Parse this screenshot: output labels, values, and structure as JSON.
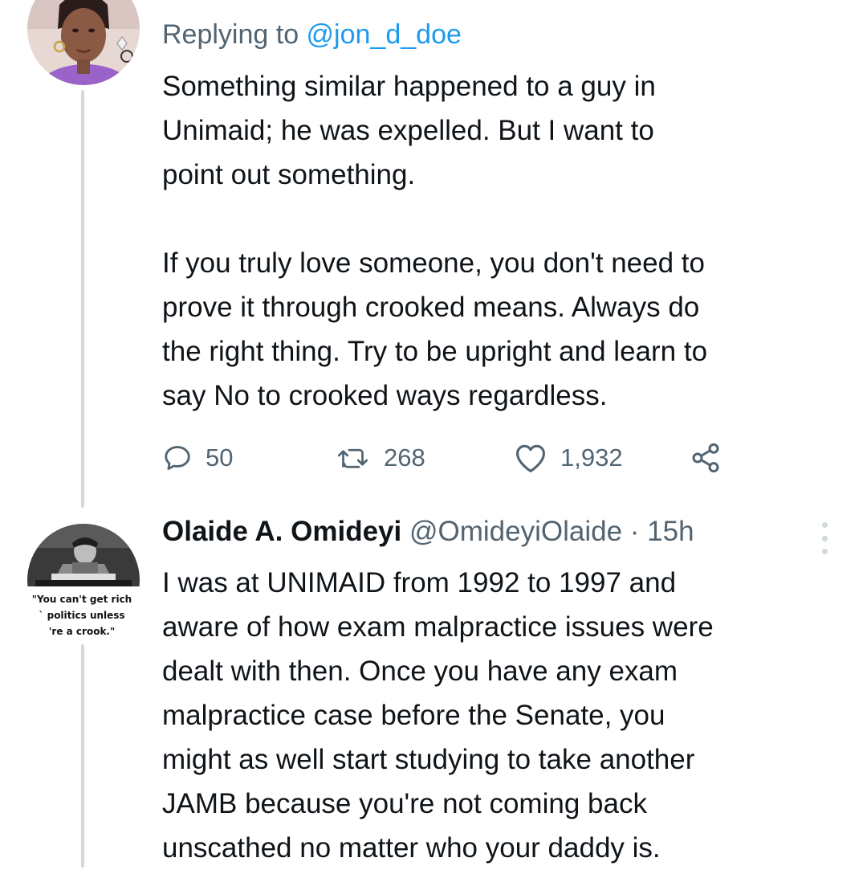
{
  "reply_tweet": {
    "replying_to_prefix": "Replying to ",
    "replying_to_handle": "@jon_d_doe",
    "text": "Something similar happened to a guy in\nUnimaid; he was expelled. But I want to\npoint out something.\n\nIf you truly love someone, you don't need to\nprove it through crooked means. Always do\nthe right thing. Try to be upright and learn to\nsay No to crooked ways regardless.",
    "actions": {
      "replies": "50",
      "retweets": "268",
      "likes": "1,932"
    }
  },
  "next_tweet": {
    "author_name": "Olaide A. Omideyi",
    "author_handle": "@OmideyiOlaide",
    "separator": " · ",
    "time": "15h",
    "avatar_caption": "\"You can't get rich\n` politics unless\n're a crook.\"",
    "text": "I was at UNIMAID from 1992 to 1997 and\naware of how exam malpractice issues were\ndealt with then. Once you have any exam\nmalpractice case before the Senate, you\nmight as well start studying to take another\nJAMB because you're not coming back\nunscathed no matter who your daddy is."
  },
  "icons": {
    "reply": "reply-icon",
    "retweet": "retweet-icon",
    "like": "heart-icon",
    "share": "share-icon",
    "more": "more-vertical-icon"
  },
  "colors": {
    "text": "#0f1419",
    "secondary": "#536471",
    "link": "#1d9bf0",
    "thread_line": "#cfd9de"
  }
}
